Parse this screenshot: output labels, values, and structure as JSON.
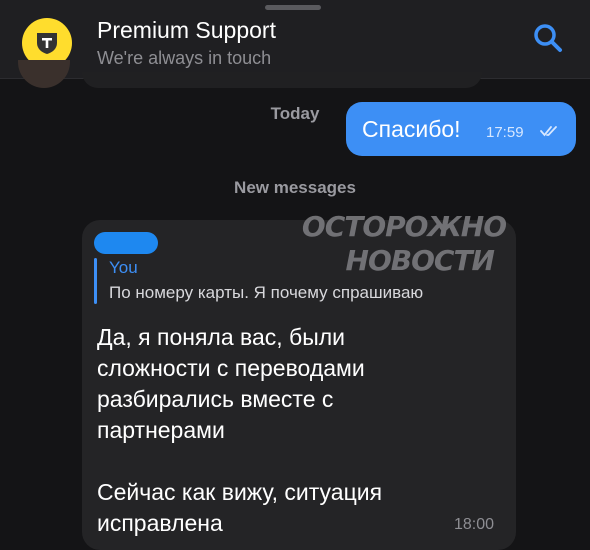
{
  "header": {
    "title": "Premium Support",
    "subtitle": "We're always in touch",
    "avatar_icon": "bank-shield-logo",
    "accent_color": "#ffdd2d",
    "search_icon": "search-icon"
  },
  "chat": {
    "date_label": "Today",
    "outgoing": {
      "text": "Спасибо!",
      "time": "17:59",
      "status_icon": "double-check-icon",
      "bubble_color": "#3d8ff5"
    },
    "new_messages_label": "New messages",
    "incoming": {
      "reply_author": "You",
      "reply_text": "По номеру карты. Я почему спрашиваю",
      "text": "Да, я поняла вас, были\nсложности с переводами\nразбирались вместе с\nпартнерами\n\nСейчас как вижу, ситуация\nисправлена",
      "time": "18:00"
    }
  },
  "watermark": {
    "line1": "ОСТОРОЖНО",
    "line2": "НОВОСТИ"
  }
}
